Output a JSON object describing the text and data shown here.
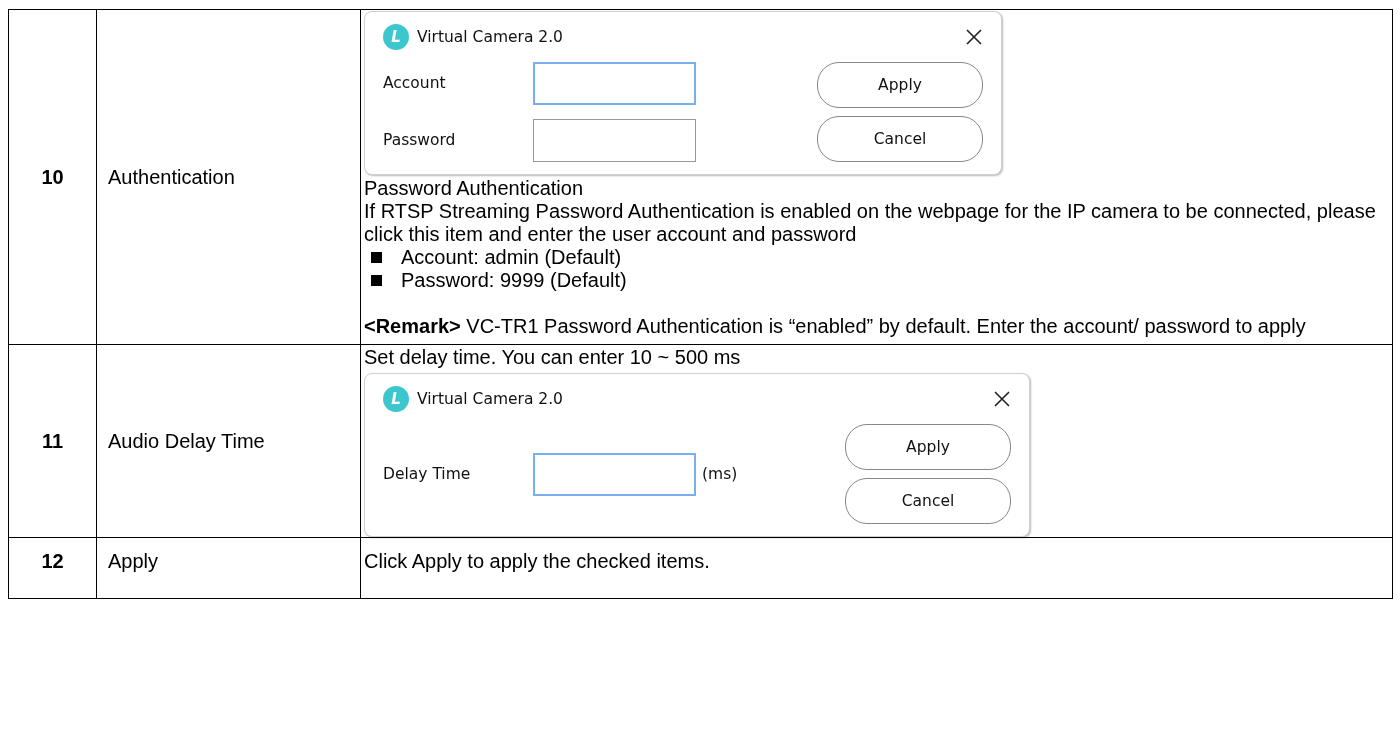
{
  "rows": [
    {
      "number": "10",
      "item": "Authentication",
      "blocks": [
        {
          "kind": "dialog",
          "icon_letter": "L",
          "title": "Virtual Camera 2.0",
          "fields": [
            {
              "label": "Account",
              "focused": true
            },
            {
              "label": "Password",
              "focused": false
            }
          ],
          "buttons": [
            "Apply",
            "Cancel"
          ]
        },
        {
          "kind": "text",
          "text": "Password Authentication"
        },
        {
          "kind": "text",
          "text": "If RTSP Streaming Password Authentication is enabled on the webpage for the IP camera to be connected, please click this item and enter the user account and password"
        },
        {
          "kind": "bullets",
          "items": [
            "Account: admin (Default)",
            "Password: 9999 (Default)"
          ]
        },
        {
          "kind": "remark",
          "text": "**<Remark>** VC-TR1 Password Authentication is “enabled” by default. Enter the account/ password to apply"
        }
      ]
    },
    {
      "number": "11",
      "item": "Audio Delay Time",
      "blocks": [
        {
          "kind": "text",
          "text": "Set delay time. You can enter 10 ~ 500 ms"
        },
        {
          "kind": "dialog",
          "icon_letter": "L",
          "title": "Virtual Camera 2.0",
          "fields": [
            {
              "label": "Delay Time",
              "focused": true,
              "unit": "(ms)"
            }
          ],
          "buttons": [
            "Apply",
            "Cancel"
          ]
        }
      ]
    },
    {
      "number": "12",
      "item": "Apply",
      "blocks": [
        {
          "kind": "text",
          "text": "Click Apply to apply the checked items."
        }
      ]
    }
  ]
}
